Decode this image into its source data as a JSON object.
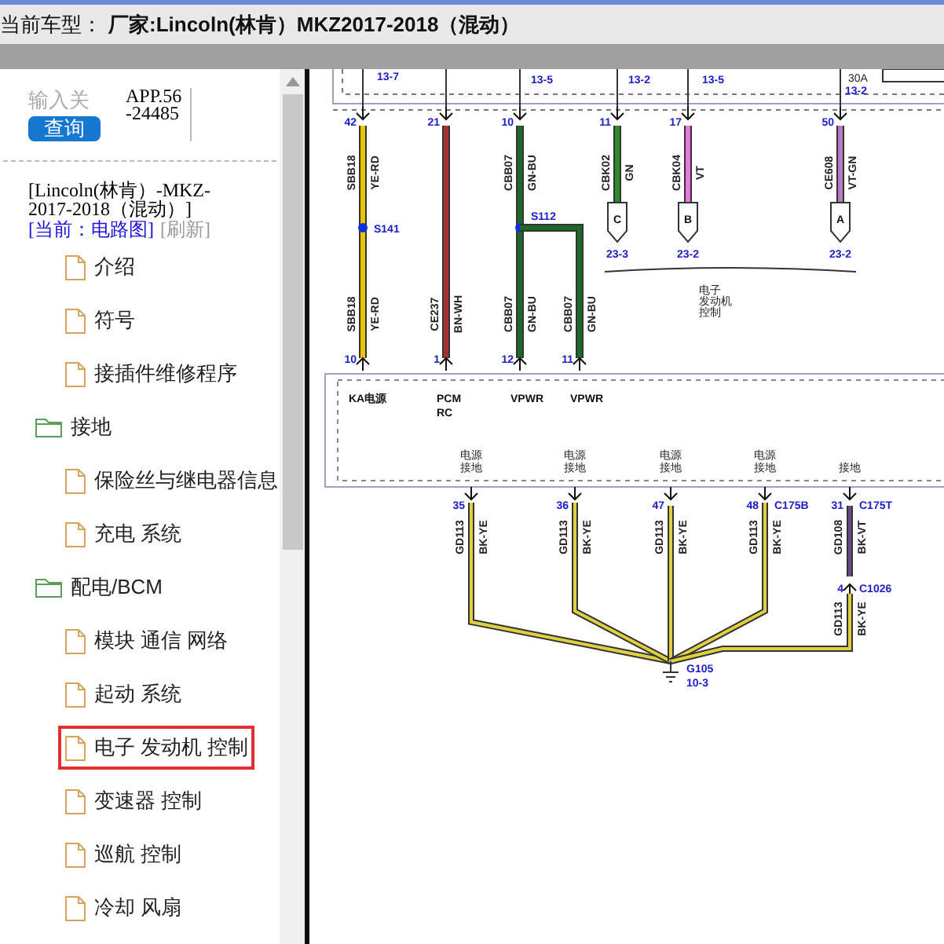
{
  "header": {
    "title": "当前车型：",
    "vehicle": "厂家:Lincoln(林肯）MKZ2017-2018（混动）"
  },
  "sidebar": {
    "search": {
      "placeholder": "输入关"
    },
    "search_button": "查询",
    "app_code": "APP.56-24485",
    "vehicle": "[Lincoln(林肯）-MKZ-2017-2018（混动）]",
    "current": "[当前：电路图]",
    "refresh": "[刷新]",
    "items": [
      {
        "kind": "file",
        "label": "介绍",
        "selected": false
      },
      {
        "kind": "file",
        "label": "符号",
        "selected": false
      },
      {
        "kind": "file",
        "label": "接插件维修程序",
        "selected": false
      },
      {
        "kind": "folder",
        "label": "接地",
        "selected": false
      },
      {
        "kind": "file",
        "label": "保险丝与继电器信息",
        "selected": false
      },
      {
        "kind": "file",
        "label": "充电 系统",
        "selected": false
      },
      {
        "kind": "folder",
        "label": "配电/BCM",
        "selected": false
      },
      {
        "kind": "file",
        "label": "模块 通信 网络",
        "selected": false
      },
      {
        "kind": "file",
        "label": "起动 系统",
        "selected": false
      },
      {
        "kind": "file",
        "label": "电子 发动机 控制",
        "selected": true
      },
      {
        "kind": "file",
        "label": "变速器 控制",
        "selected": false
      },
      {
        "kind": "file",
        "label": "巡航 控制",
        "selected": false
      },
      {
        "kind": "file",
        "label": "冷却 风扇",
        "selected": false
      }
    ]
  },
  "diagram": {
    "top_refs": [
      {
        "text": "13-7",
        "kind": "ref"
      },
      {
        "text": "13-5",
        "kind": "ref"
      },
      {
        "text": "13-2",
        "kind": "ref"
      },
      {
        "text": "13-5",
        "kind": "ref"
      },
      {
        "text": "30A",
        "kind": "rating"
      },
      {
        "text": "13-2",
        "kind": "ref"
      }
    ],
    "wires": [
      {
        "kind": "through",
        "top_pin": "42",
        "upper": {
          "circuit": "SBB18",
          "color_code": "YE-RD"
        },
        "splice": "S141",
        "lower": {
          "circuit": "SBB18",
          "color_code": "YE-RD"
        },
        "bottom_pin": "10",
        "terminal": [
          "KA电源"
        ],
        "color": "#e8c400"
      },
      {
        "kind": "through",
        "top_pin": "21",
        "lower": {
          "circuit": "CE237",
          "color_code": "BN-WH"
        },
        "bottom_pin": "1",
        "terminal": [
          "PCM",
          "RC"
        ],
        "color": "#a3322c"
      },
      {
        "kind": "through",
        "top_pin": "10",
        "upper": {
          "circuit": "CBB07",
          "color_code": "GN-BU"
        },
        "splice": "S112",
        "lower": {
          "circuit": "CBB07",
          "color_code": "GN-BU"
        },
        "bottom_pin": "12",
        "terminal": [
          "VPWR"
        ],
        "color": "#1d6a28"
      },
      {
        "kind": "branch",
        "lower": {
          "circuit": "CBB07",
          "color_code": "GN-BU"
        },
        "bottom_pin": "11",
        "terminal": [
          "VPWR"
        ],
        "color": "#1d6a28"
      },
      {
        "kind": "connector",
        "top_pin": "11",
        "upper": {
          "circuit": "CBK02",
          "color_code": "GN"
        },
        "connector": "C",
        "ref": "23-3",
        "color": "#2a8c2a"
      },
      {
        "kind": "connector",
        "top_pin": "17",
        "upper": {
          "circuit": "CBK04",
          "color_code": "VT"
        },
        "connector": "B",
        "ref": "23-2",
        "color": "#e878e0"
      },
      {
        "kind": "connector",
        "top_pin": "50",
        "upper": {
          "circuit": "CE608",
          "color_code": "VT-GN"
        },
        "connector": "A",
        "ref": "23-2",
        "color": "#b47ac4"
      }
    ],
    "module_label": [
      "电子",
      "发动机",
      "控制"
    ],
    "grounds": [
      {
        "label": [
          "电源",
          "接地"
        ],
        "pin": "35",
        "segments": [
          {
            "circuit": "GD113",
            "color_code": "BK-YE",
            "color": "#e0d040"
          }
        ]
      },
      {
        "label": [
          "电源",
          "接地"
        ],
        "pin": "36",
        "segments": [
          {
            "circuit": "GD113",
            "color_code": "BK-YE",
            "color": "#e0d040"
          }
        ]
      },
      {
        "label": [
          "电源",
          "接地"
        ],
        "pin": "47",
        "segments": [
          {
            "circuit": "GD113",
            "color_code": "BK-YE",
            "color": "#e0d040"
          }
        ]
      },
      {
        "label": [
          "电源",
          "接地"
        ],
        "pin": "48",
        "connector": "C175B",
        "segments": [
          {
            "circuit": "GD113",
            "color_code": "BK-YE",
            "color": "#e0d040"
          }
        ]
      },
      {
        "label": [
          "接地"
        ],
        "pin": "31",
        "connector": "C175T",
        "segments": [
          {
            "circuit": "GD108",
            "color_code": "BK-VT",
            "color": "#6a4a8a"
          },
          {
            "pin": "4",
            "connector": "C1026",
            "circuit": "GD113",
            "color_code": "BK-YE",
            "color": "#e0d040"
          }
        ]
      }
    ],
    "ground_point": {
      "name": "G105",
      "ref": "10-3"
    }
  }
}
